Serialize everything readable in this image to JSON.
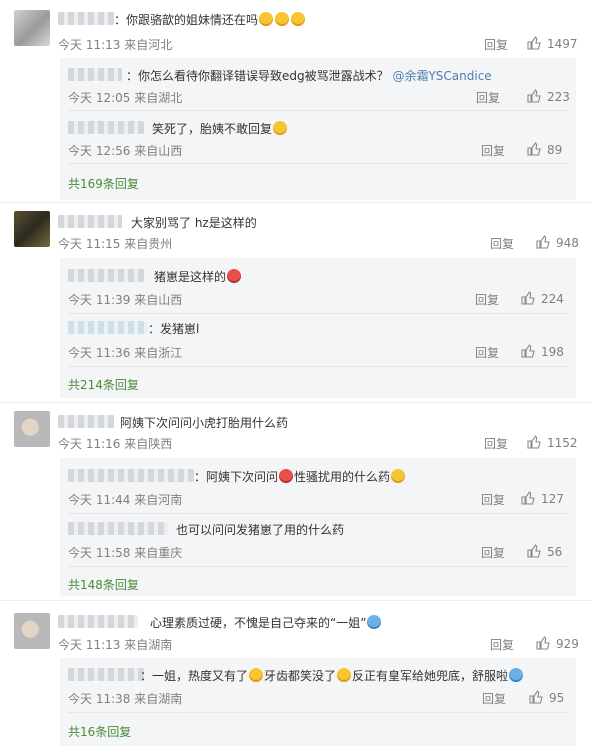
{
  "reply_label": "回复",
  "comments": [
    {
      "text": "：你跟骆歆的姐妹情还在吗",
      "time": "今天 11:13 来自河北",
      "likes": "1497",
      "replies": [
        {
          "text": "：你怎么看待你翻译错误导致edg被骂泄露战术？",
          "mention": "@余霜YSCandice",
          "time": "今天 12:05 来自湖北",
          "likes": "223"
        },
        {
          "text": "笑死了，胎姨不敢回复",
          "time": "今天 12:56 来自山西",
          "likes": "89"
        }
      ],
      "more": "共169条回复"
    },
    {
      "text": "大家别骂了 hz是这样的",
      "time": "今天 11:15 来自贵州",
      "likes": "948",
      "replies": [
        {
          "text": "猪崽是这样的",
          "time": "今天 11:39 来自山西",
          "likes": "224"
        },
        {
          "text": "：发猪崽l",
          "time": "今天 11:36 来自浙江",
          "likes": "198"
        }
      ],
      "more": "共214条回复"
    },
    {
      "text": "阿姨下次问问小虎打胎用什么药",
      "time": "今天 11:16 来自陕西",
      "likes": "1152",
      "replies": [
        {
          "text": "：阿姨下次问问",
          "text2": "性骚扰用的什么药",
          "time": "今天 11:44 来自河南",
          "likes": "127"
        },
        {
          "text": "也可以问问发猪崽了用的什么药",
          "time": "今天 11:58 来自重庆",
          "likes": "56"
        }
      ],
      "more": "共148条回复"
    },
    {
      "text": "心理素质过硬，不愧是自己夺来的“一姐”",
      "time": "今天 11:13 来自湖南",
      "likes": "929",
      "replies": [
        {
          "text": "：一姐，热度又有了",
          "text2": "牙齿都笑没了",
          "text3": "反正有皇军给她兜底，舒服啦",
          "time": "今天 11:38 来自湖南",
          "likes": "95"
        }
      ],
      "more": "共16条回复"
    }
  ]
}
